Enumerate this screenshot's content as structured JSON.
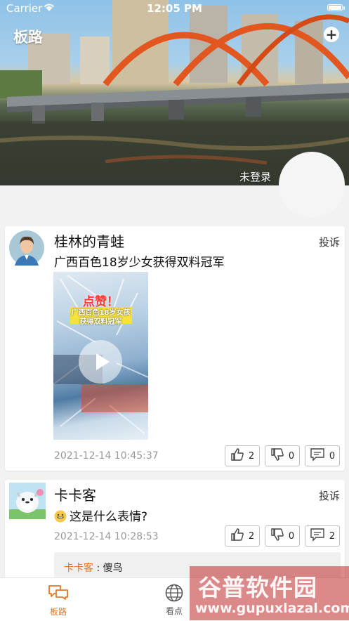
{
  "status_bar": {
    "carrier": "Carrier",
    "time": "12:05 PM"
  },
  "header": {
    "title": "板路",
    "login_status": "未登录"
  },
  "posts": [
    {
      "username": "桂林的青蛙",
      "report_label": "投诉",
      "content": "广西百色18岁少女获得双料冠军",
      "image": {
        "badge": "点赞！",
        "headline_line1": "广西百色18岁女孩",
        "headline_line2": "获得双料冠军"
      },
      "time": "2021-12-14 10:45:37",
      "likes": "2",
      "dislikes": "0",
      "comments": "0"
    },
    {
      "username": "卡卡客",
      "report_label": "投诉",
      "content": "这是什么表情?",
      "time": "2021-12-14 10:28:53",
      "likes": "2",
      "dislikes": "0",
      "comments": "2",
      "reply": {
        "name": "卡卡客",
        "separator": " : ",
        "text": "傻鸟"
      }
    }
  ],
  "tabbar": {
    "tabs": [
      {
        "label": "板路",
        "active": true
      },
      {
        "label": "看点",
        "active": false
      }
    ]
  },
  "watermark": {
    "title": "谷普软件园",
    "url": "www.gupuxlazal.com"
  },
  "colors": {
    "accent": "#e07a2c",
    "tab_inactive": "#555555"
  }
}
